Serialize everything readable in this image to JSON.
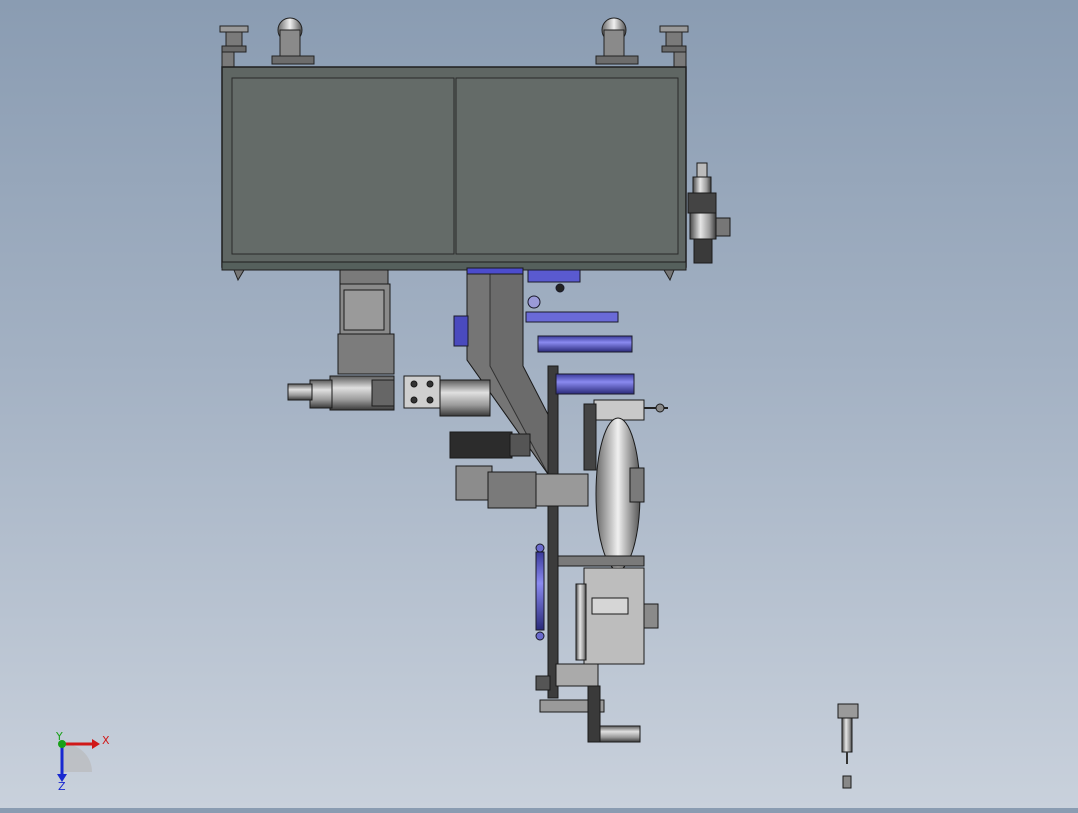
{
  "viewport": {
    "background_top": "#8a9cb2",
    "background_bottom": "#c9d1dc"
  },
  "triad": {
    "x_label": "X",
    "y_label": "Y",
    "z_label": "Z",
    "x_color": "#d01818",
    "y_color": "#18a018",
    "z_color": "#1828d0"
  },
  "model": {
    "frame_color": "#5f6663",
    "accent_color": "#5a5acf",
    "steel_color": "#8c8c8c",
    "dark_color": "#2e2e2e"
  }
}
